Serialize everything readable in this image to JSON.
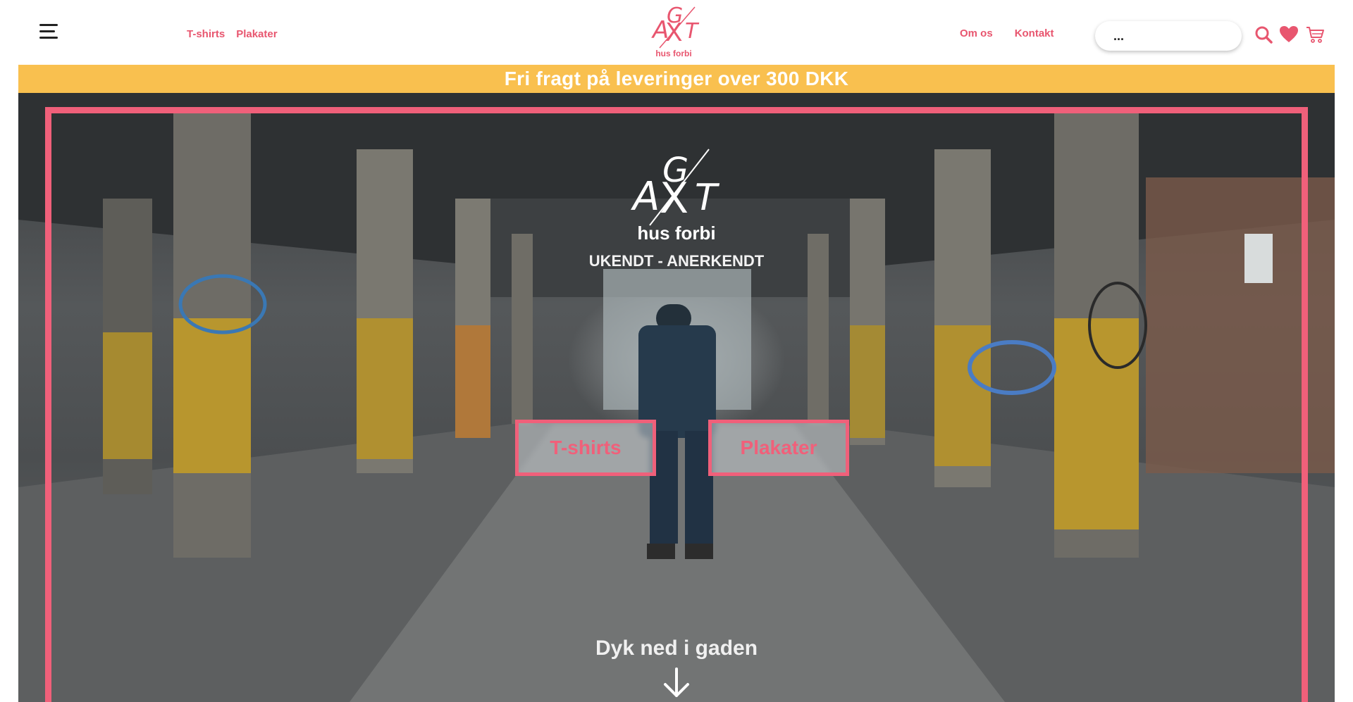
{
  "header": {
    "nav_left": [
      "T-shirts",
      "Plakater"
    ],
    "logo_letters": {
      "a": "A",
      "g": "G",
      "x": "X",
      "t": "T"
    },
    "logo_subtitle": "hus forbi",
    "nav_right": [
      "Om os",
      "Kontakt"
    ],
    "search": {
      "value": "...",
      "placeholder": ""
    },
    "icons": [
      "menu-icon",
      "search-icon",
      "heart-icon",
      "cart-icon"
    ]
  },
  "shipping_banner": {
    "text": "Fri fragt på leveringer over 300 DKK"
  },
  "hero": {
    "brand": "hus forbi",
    "tagline": "UKENDT - ANERKENDT",
    "buttons": [
      "T-shirts",
      "Plakater"
    ],
    "scroll_prompt": "Dyk ned i gaden",
    "scroll_icon": "arrow-down-icon"
  },
  "colors": {
    "brand_pink": "#f0607a",
    "banner_yellow": "#f9c04f",
    "header_bg": "#ffffff"
  }
}
